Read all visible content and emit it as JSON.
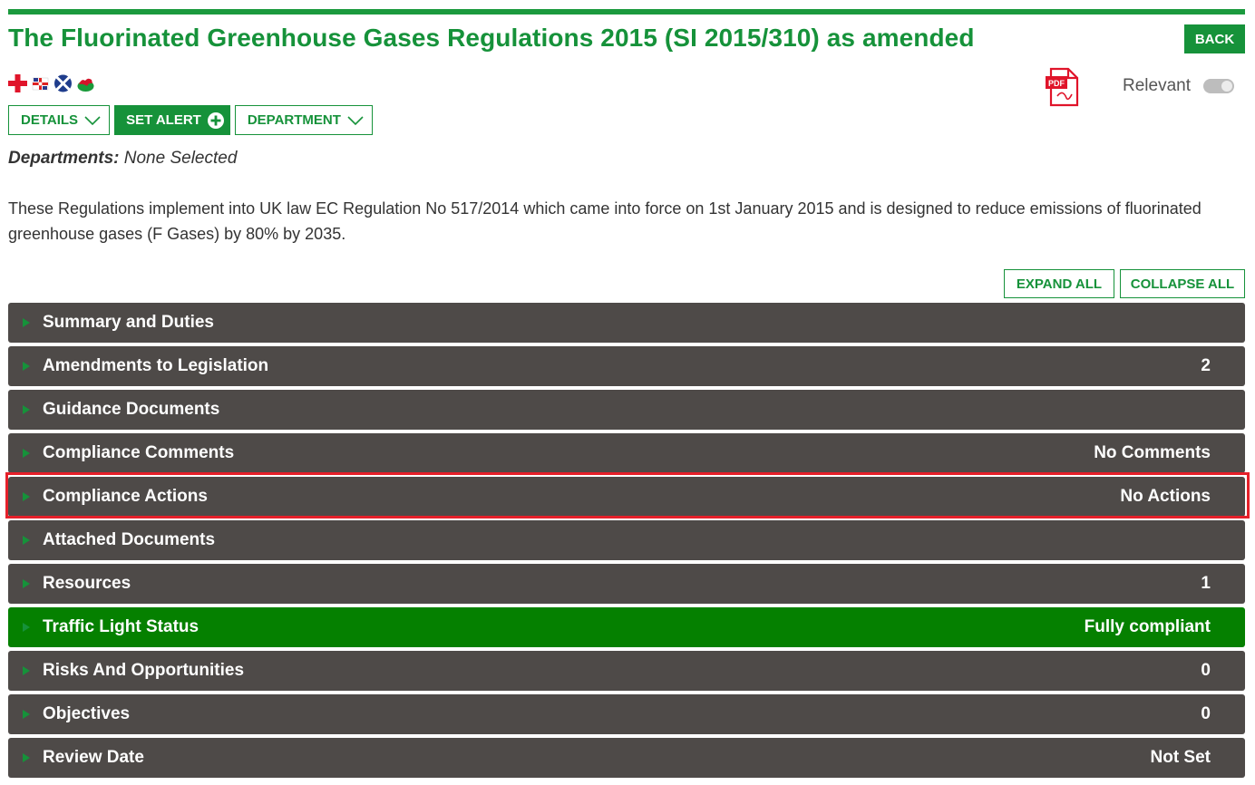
{
  "page": {
    "title": "The Fluorinated Greenhouse Gases Regulations 2015 (SI 2015/310) as amended",
    "back_label": "BACK",
    "relevant_label": "Relevant",
    "relevant_on": false
  },
  "flags": [
    "england-flag-icon",
    "northern-ireland-flag-icon",
    "scotland-flag-icon",
    "wales-flag-icon"
  ],
  "toolbar": {
    "details_label": "DETAILS",
    "set_alert_label": "SET ALERT",
    "department_label": "DEPARTMENT"
  },
  "departments": {
    "label": "Departments:",
    "value": "None Selected"
  },
  "description": "These Regulations implement into UK law EC Regulation No 517/2014 which came into force on 1st January 2015 and is designed to reduce emissions of fluorinated greenhouse gases (F Gases) by 80% by 2035.",
  "controls": {
    "expand_all": "EXPAND ALL",
    "collapse_all": "COLLAPSE ALL"
  },
  "sections": [
    {
      "label": "Summary and Duties",
      "value": ""
    },
    {
      "label": "Amendments to Legislation",
      "value": "2"
    },
    {
      "label": "Guidance Documents",
      "value": ""
    },
    {
      "label": "Compliance Comments",
      "value": "No Comments"
    },
    {
      "label": "Compliance Actions",
      "value": "No Actions"
    },
    {
      "label": "Attached Documents",
      "value": ""
    },
    {
      "label": "Resources",
      "value": "1"
    },
    {
      "label": "Traffic Light Status",
      "value": "Fully compliant"
    },
    {
      "label": "Risks And Opportunities",
      "value": "0"
    },
    {
      "label": "Objectives",
      "value": "0"
    },
    {
      "label": "Review Date",
      "value": "Not Set"
    }
  ],
  "colors": {
    "brand_green": "#16923a",
    "section_dark": "#4e4a48",
    "status_green": "#058000",
    "highlight_red": "#e5202a"
  }
}
